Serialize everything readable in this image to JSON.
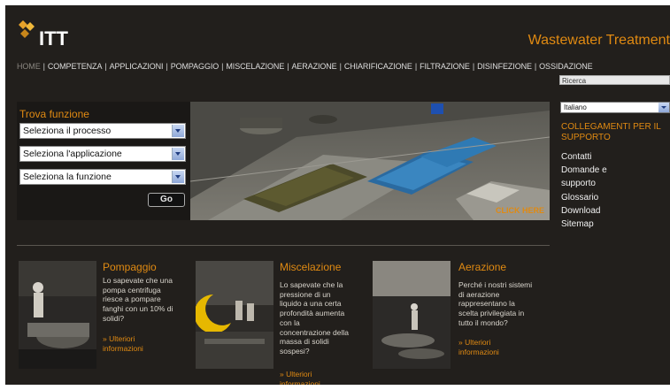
{
  "header": {
    "logo_text": "ITT",
    "site_title": "Wastewater Treatment"
  },
  "nav": {
    "items": [
      "HOME",
      "COMPETENZA",
      "APPLICAZIONI",
      "POMPAGGIO",
      "MISCELAZIONE",
      "AERAZIONE",
      "CHIARIFICAZIONE",
      "FILTRAZIONE",
      "DISINFEZIONE",
      "OSSIDAZIONE"
    ],
    "separator": "|"
  },
  "search": {
    "value": "Ricerca"
  },
  "finder": {
    "title": "Trova funzione",
    "selects": [
      "Seleziona il processo",
      "Seleziona l'applicazione",
      "Seleziona la funzione"
    ],
    "go_label": "Go"
  },
  "hero": {
    "click_here": "CLICK HERE"
  },
  "sidebar": {
    "language": "Italiano",
    "support_title": "COLLEGAMENTI PER IL SUPPORTO",
    "links": [
      "Contatti",
      "Domande e",
      "supporto",
      "Glossario",
      "Download",
      "Sitemap"
    ]
  },
  "cards": [
    {
      "title": "Pompaggio",
      "text": [
        "Lo sapevate che una",
        "pompa centrifuga",
        "riesce a pompare",
        "fanghi con un 10% di",
        "solidi?"
      ],
      "more": [
        "» Ulteriori",
        "informazioni"
      ]
    },
    {
      "title": "Miscelazione",
      "text": [
        "Lo sapevate che la",
        "pressione di un",
        "liquido a una certa",
        "profondità aumenta",
        "con la",
        "concentrazione della",
        "massa di solidi",
        "sospesi?"
      ],
      "more": [
        "» Ulteriori",
        "informazioni"
      ]
    },
    {
      "title": "Aerazione",
      "text": [
        "Perché i nostri sistemi",
        "di aerazione",
        "rappresentano la",
        "scelta privilegiata in",
        "tutto il mondo?"
      ],
      "more": [
        "» Ulteriori",
        "informazioni"
      ]
    }
  ],
  "colors": {
    "background": "#221f1c",
    "accent": "#e08a12"
  }
}
